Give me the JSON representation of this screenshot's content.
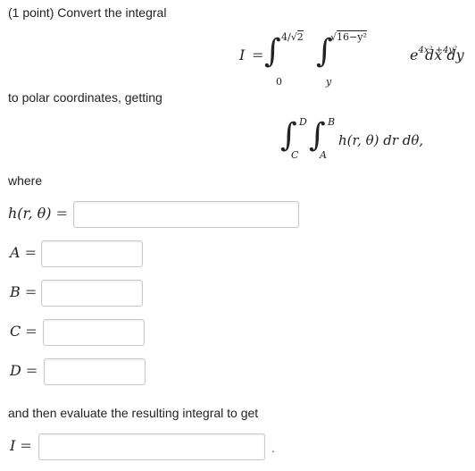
{
  "problem": {
    "points": "(1 point) Convert the integral",
    "polar_intro": "to polar coordinates, getting",
    "where_text": "where",
    "evaluate_text": "and then evaluate the resulting integral to get",
    "trailing_period": "."
  },
  "integral": {
    "lhs": "I",
    "equals": "=",
    "outer_lower": "0",
    "outer_upper_num": "4/",
    "outer_upper_rad": "2",
    "inner_lower": "y",
    "inner_upper_rad": "16−y²",
    "integrand_base": "e",
    "integrand_exp": "4x² +4y²",
    "differentials": "dx dy"
  },
  "polar_integral": {
    "outer_lower": "C",
    "outer_upper": "D",
    "inner_lower": "A",
    "inner_upper": "B",
    "integrand": "h(r, θ) dr dθ,"
  },
  "fields": {
    "h": {
      "label": "h(r, θ)",
      "equals": "=",
      "value": ""
    },
    "A": {
      "label": "A",
      "equals": "=",
      "value": ""
    },
    "B": {
      "label": "B",
      "equals": "=",
      "value": ""
    },
    "C": {
      "label": "C",
      "equals": "=",
      "value": ""
    },
    "D": {
      "label": "D",
      "equals": "=",
      "value": ""
    },
    "I": {
      "label": "I",
      "equals": "=",
      "value": ""
    }
  }
}
